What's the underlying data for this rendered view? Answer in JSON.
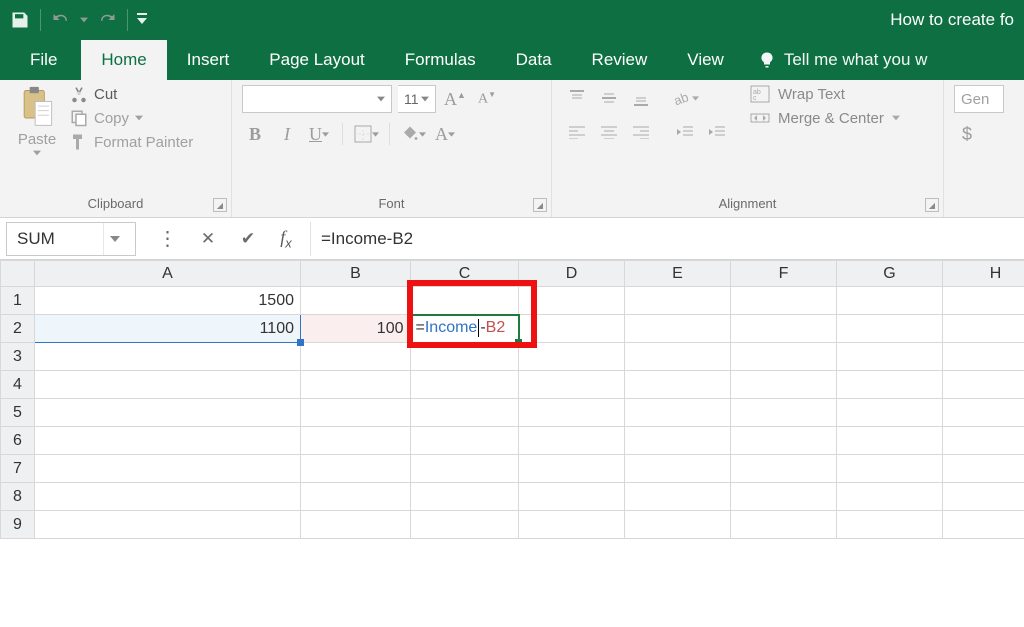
{
  "title": "How to create fo",
  "tabs": {
    "file": "File",
    "home": "Home",
    "insert": "Insert",
    "page_layout": "Page Layout",
    "formulas": "Formulas",
    "data": "Data",
    "review": "Review",
    "view": "View",
    "tell_me": "Tell me what you w"
  },
  "ribbon": {
    "clipboard": {
      "label": "Clipboard",
      "paste": "Paste",
      "cut": "Cut",
      "copy": "Copy",
      "format_painter": "Format Painter"
    },
    "font": {
      "label": "Font",
      "font_name": "",
      "font_size": "11"
    },
    "alignment": {
      "label": "Alignment",
      "wrap_text": "Wrap Text",
      "merge_center": "Merge & Center"
    },
    "number": {
      "label_short": "Gen",
      "currency": "$"
    }
  },
  "name_box": "SUM",
  "formula_bar": "=Income-B2",
  "columns": [
    "A",
    "B",
    "C",
    "D",
    "E",
    "F",
    "G",
    "H"
  ],
  "rows": [
    "1",
    "2",
    "3",
    "4",
    "5",
    "6",
    "7",
    "8",
    "9"
  ],
  "cells": {
    "A1": "1500",
    "A2": "1100",
    "B2": "100",
    "C2_prefix": "=",
    "C2_income": "Income",
    "C2_minus": "-",
    "C2_ref": "B2"
  },
  "chart_data": {
    "type": "table",
    "columns": [
      "A",
      "B",
      "C"
    ],
    "rows": [
      {
        "A": 1500,
        "B": null,
        "C": null
      },
      {
        "A": 1100,
        "B": 100,
        "C": "=Income-B2"
      }
    ],
    "active_cell": "C2",
    "named_ranges": {
      "Income": "A2"
    }
  }
}
